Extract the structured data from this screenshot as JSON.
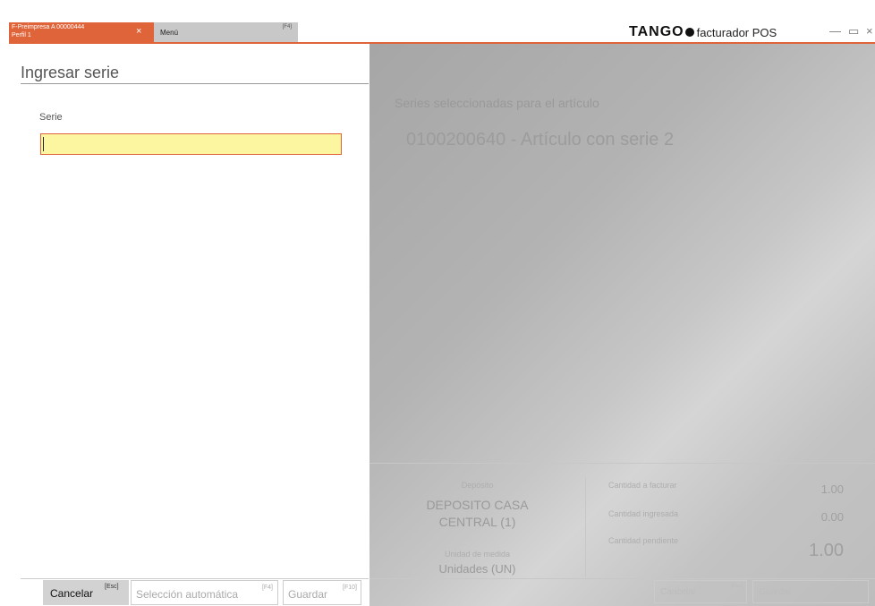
{
  "tabs": [
    {
      "line1": "F-Preimpresa A 00000444",
      "line2": "Perfil 1",
      "close": "×"
    },
    {
      "label": "Menú",
      "shortcut": "[F4]"
    }
  ],
  "brand": {
    "logo": "TANGO",
    "product": "facturador POS"
  },
  "window_controls": {
    "minimize": "—",
    "maximize": "▭",
    "close": "×"
  },
  "left_panel": {
    "title": "Ingresar serie",
    "serie_label": "Serie",
    "serie_value": ""
  },
  "buttons": {
    "cancel": {
      "label": "Cancelar",
      "shortcut": "[Esc]"
    },
    "auto": {
      "label": "Selección automática",
      "shortcut": "[F4]"
    },
    "save": {
      "label": "Guardar",
      "shortcut": "[F10]"
    }
  },
  "right_panel": {
    "section_title": "Series seleccionadas para el artículo",
    "article": "0100200640  -  Artículo con serie 2",
    "deposito_label": "Depósito",
    "deposito_line1": "DEPOSITO CASA",
    "deposito_line2": "CENTRAL (1)",
    "unidad_label": "Unidad de medida",
    "unidad_value": "Unidades (UN)",
    "cantidad_facturar_label": "Cantidad a facturar",
    "cantidad_facturar": "1.00",
    "cantidad_ingresada_label": "Cantidad ingresada",
    "cantidad_ingresada": "0.00",
    "cantidad_pendiente_label": "Cantidad pendiente",
    "cantidad_pendiente": "1.00",
    "footer_buttons": [
      {
        "label": "Cancelar",
        "shortcut": "[Esc]"
      },
      {
        "label": "Guardar",
        "shortcut": "[F10]"
      }
    ]
  }
}
